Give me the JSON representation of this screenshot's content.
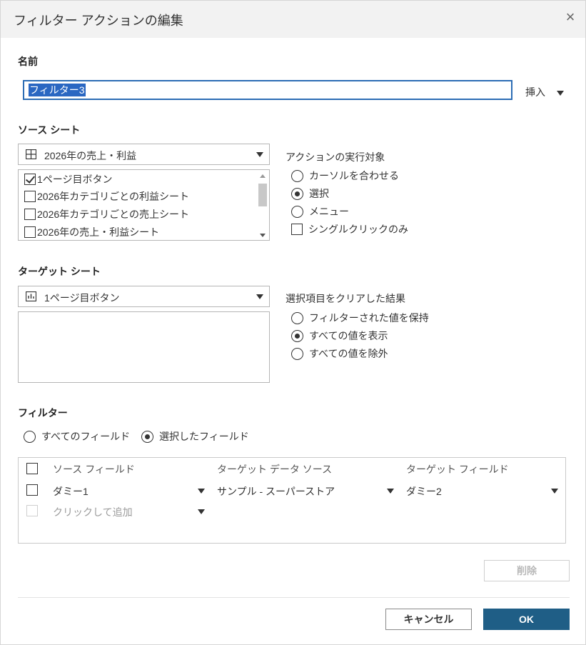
{
  "dialog": {
    "title": "フィルター アクションの編集",
    "close_glyph": "×"
  },
  "name_section": {
    "label": "名前",
    "value": "フィルター3",
    "insert_label": "挿入"
  },
  "source_section": {
    "label": "ソース シート",
    "dropdown_value": "2026年の売上・利益",
    "sheets": [
      {
        "label": "1ページ目ボタン",
        "checked": true
      },
      {
        "label": "2026年カテゴリごとの利益シート",
        "checked": false
      },
      {
        "label": "2026年カテゴリごとの売上シート",
        "checked": false
      },
      {
        "label": "2026年の売上・利益シート",
        "checked": false
      }
    ],
    "run_on": {
      "label": "アクションの実行対象",
      "options": [
        {
          "label": "カーソルを合わせる",
          "selected": false
        },
        {
          "label": "選択",
          "selected": true
        },
        {
          "label": "メニュー",
          "selected": false
        }
      ],
      "single_click_label": "シングルクリックのみ",
      "single_click_checked": false
    }
  },
  "target_section": {
    "label": "ターゲット シート",
    "dropdown_value": "1ページ目ボタン",
    "clear_result": {
      "label": "選択項目をクリアした結果",
      "options": [
        {
          "label": "フィルターされた値を保持",
          "selected": false
        },
        {
          "label": "すべての値を表示",
          "selected": true
        },
        {
          "label": "すべての値を除外",
          "selected": false
        }
      ]
    }
  },
  "filter_section": {
    "label": "フィルター",
    "scope_options": [
      {
        "label": "すべてのフィールド",
        "selected": false
      },
      {
        "label": "選択したフィールド",
        "selected": true
      }
    ],
    "columns": [
      "ソース フィールド",
      "ターゲット データ ソース",
      "ターゲット フィールド"
    ],
    "rows": [
      {
        "source_field": "ダミー1",
        "target_source": "サンプル - スーパーストア",
        "target_field": "ダミー2"
      }
    ],
    "add_placeholder": "クリックして追加"
  },
  "buttons": {
    "delete": "削除",
    "cancel": "キャンセル",
    "ok": "OK"
  }
}
